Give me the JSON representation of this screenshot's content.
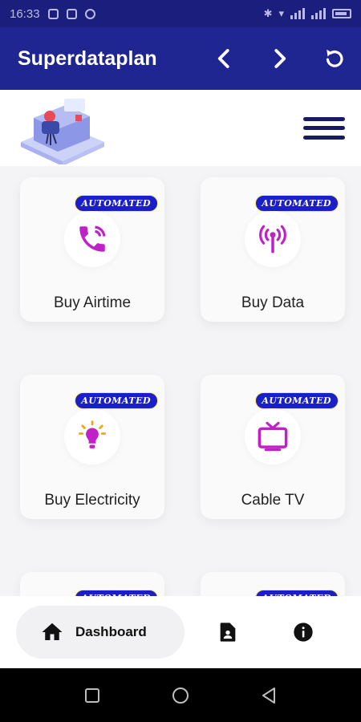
{
  "status_bar": {
    "time": "16:33"
  },
  "app_bar": {
    "title": "Superdataplan",
    "back_icon": "chevron-left-icon",
    "forward_icon": "chevron-right-icon",
    "refresh_icon": "refresh-icon"
  },
  "header": {
    "logo_icon": "office-desk-logo",
    "menu_icon": "hamburger-menu-icon"
  },
  "services": [
    {
      "label": "Buy Airtime",
      "badge": "AUTOMATED",
      "icon": "phone-ringing-icon"
    },
    {
      "label": "Buy Data",
      "badge": "AUTOMATED",
      "icon": "antenna-signal-icon"
    },
    {
      "label": "Buy Electricity",
      "badge": "AUTOMATED",
      "icon": "light-bulb-icon"
    },
    {
      "label": "Cable TV",
      "badge": "AUTOMATED",
      "icon": "tv-icon"
    },
    {
      "label": "",
      "badge": "AUTOMATED",
      "icon": ""
    },
    {
      "label": "",
      "badge": "AUTOMATED",
      "icon": ""
    }
  ],
  "bottom_nav": {
    "dashboard_label": "Dashboard",
    "dashboard_icon": "home-icon",
    "profile_icon": "contact-file-icon",
    "info_icon": "info-icon"
  },
  "colors": {
    "primary": "#1f2591",
    "accent": "#c020c8",
    "badge": "#1a1fc9"
  }
}
